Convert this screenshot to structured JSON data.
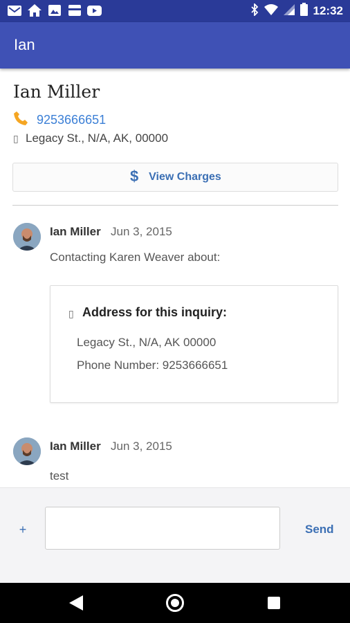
{
  "status_bar": {
    "time": "12:32",
    "icons": [
      "gmail-icon",
      "home-icon",
      "photo-icon",
      "card-icon",
      "youtube-icon",
      "bluetooth-icon",
      "wifi-icon",
      "cell-signal-icon",
      "battery-icon"
    ]
  },
  "app_bar": {
    "title": "Ian"
  },
  "contact": {
    "name": "Ian Miller",
    "phone": "9253666651",
    "address_glyph": "▯",
    "address": "Legacy St., N/A, AK, 00000",
    "view_charges_label": "View Charges"
  },
  "messages": [
    {
      "author": "Ian Miller",
      "date": "Jun 3, 2015",
      "body": "Contacting Karen Weaver about:",
      "card": {
        "glyph": "▯",
        "title": "Address for this inquiry:",
        "address": "Legacy St., N/A, AK 00000",
        "phone": "Phone Number: 9253666651"
      }
    },
    {
      "author": "Ian Miller",
      "date": "Jun 3, 2015",
      "body": "test"
    }
  ],
  "composer": {
    "plus_label": "+",
    "input_value": "",
    "send_label": "Send"
  },
  "colors": {
    "status_bar": "#2a3a98",
    "app_bar": "#3f51b5",
    "link": "#3b7fd6",
    "accent": "#3b6fb4",
    "phone_icon": "#f5a623"
  }
}
